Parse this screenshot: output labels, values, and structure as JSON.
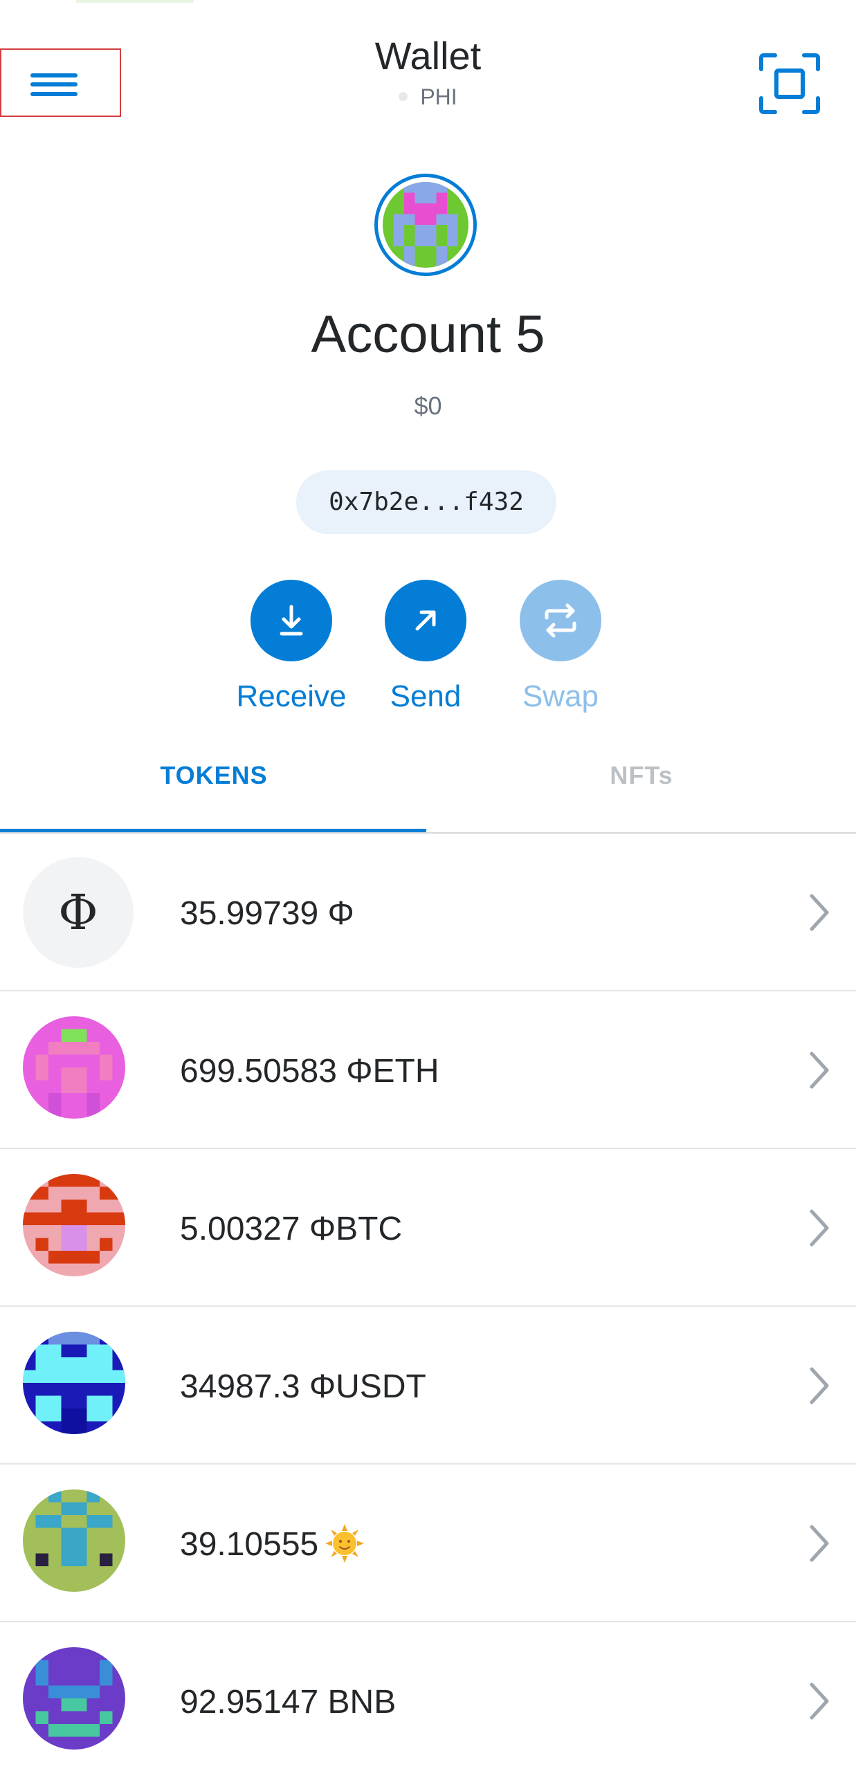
{
  "header": {
    "title": "Wallet",
    "network": "PHI",
    "menu_icon": "hamburger-menu-icon",
    "scan_icon": "scan-qr-icon"
  },
  "account": {
    "name": "Account 5",
    "balance": "$0",
    "address": "0x7b2e...f432"
  },
  "actions": [
    {
      "label": "Receive",
      "icon": "download-icon",
      "enabled": true
    },
    {
      "label": "Send",
      "icon": "arrow-up-right-icon",
      "enabled": true
    },
    {
      "label": "Swap",
      "icon": "swap-arrows-icon",
      "enabled": false
    }
  ],
  "tabs": [
    {
      "label": "TOKENS",
      "active": true
    },
    {
      "label": "NFTs",
      "active": false
    }
  ],
  "tokens": [
    {
      "amount": "35.99739 Φ",
      "icon_glyph": "Φ"
    },
    {
      "amount": "699.50583 ΦETH"
    },
    {
      "amount": "5.00327 ΦBTC"
    },
    {
      "amount": "34987.3 ΦUSDT"
    },
    {
      "amount": "39.10555",
      "emoji": "sun-face-icon"
    },
    {
      "amount": "92.95147 BNB"
    }
  ],
  "colors": {
    "accent": "#037dd6",
    "accent_disabled": "#8dbfeb",
    "text_primary": "#24272a",
    "text_secondary": "#6a737d",
    "address_pill_bg": "#e9f1fb"
  }
}
